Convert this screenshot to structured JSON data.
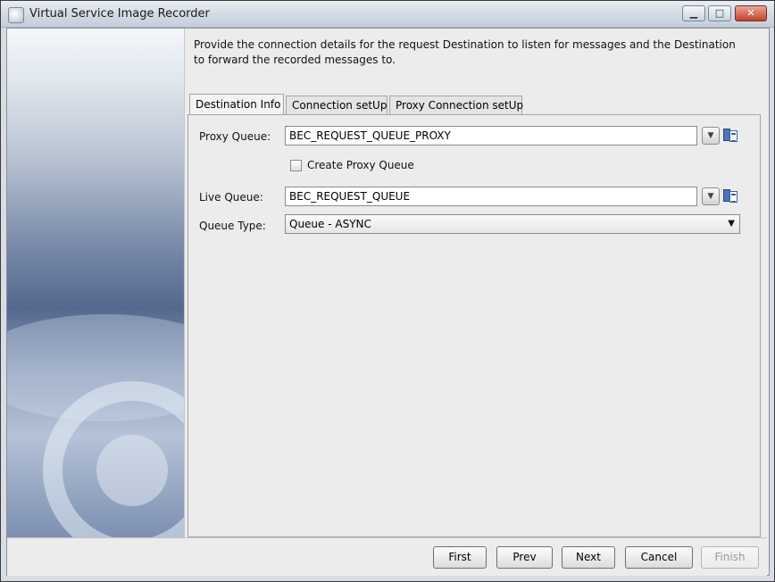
{
  "window": {
    "title": "Virtual Service Image Recorder",
    "controls": [
      "minimize-icon",
      "maximize-icon",
      "close-icon"
    ]
  },
  "description": "Provide the connection details for the request Destination to listen for messages and the Destination to forward the recorded messages to.",
  "tabs": [
    {
      "label": "Destination Info",
      "active": true
    },
    {
      "label": "Connection setUp",
      "active": false
    },
    {
      "label": "Proxy Connection setUp",
      "active": false
    }
  ],
  "form": {
    "proxy_queue": {
      "label": "Proxy Queue:",
      "value": "BEC_REQUEST_QUEUE_PROXY"
    },
    "create_proxy_queue": {
      "label": "Create Proxy Queue",
      "checked": false
    },
    "live_queue": {
      "label": "Live Queue:",
      "value": "BEC_REQUEST_QUEUE"
    },
    "queue_type": {
      "label": "Queue Type:",
      "value": "Queue - ASYNC"
    }
  },
  "buttons": {
    "first": "First",
    "prev": "Prev",
    "next": "Next",
    "cancel": "Cancel",
    "finish": "Finish"
  }
}
